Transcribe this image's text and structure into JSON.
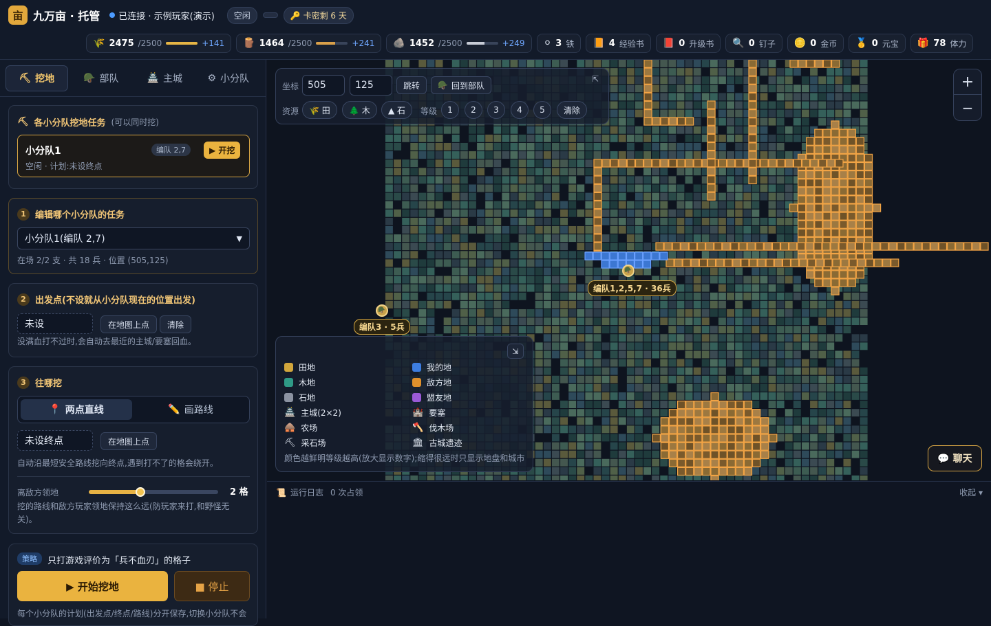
{
  "header": {
    "logo_glyph": "亩",
    "title": "九万亩 · 托管",
    "connection": "已连接 · 示例玩家(演示)",
    "status": "空闲",
    "card_key": "卡密剩 6 天"
  },
  "resources": [
    {
      "icon": "🌾",
      "value": "2475",
      "cap": "/2500",
      "gain": "+141",
      "fill": 0.99,
      "color": "#e6b545"
    },
    {
      "icon": "🪵",
      "value": "1464",
      "cap": "/2500",
      "gain": "+241",
      "fill": 0.59,
      "color": "#d9a04a"
    },
    {
      "icon": "🪨",
      "value": "1452",
      "cap": "/2500",
      "gain": "+249",
      "fill": 0.58,
      "color": "#c8ccd6"
    }
  ],
  "items": [
    {
      "icon": "⚪",
      "value": "3",
      "label": "铁"
    },
    {
      "icon": "📙",
      "value": "4",
      "label": "经验书"
    },
    {
      "icon": "📕",
      "value": "0",
      "label": "升级书"
    },
    {
      "icon": "🔍",
      "value": "0",
      "label": "钉子"
    },
    {
      "icon": "🪙",
      "value": "0",
      "label": "金币"
    },
    {
      "icon": "🥇",
      "value": "0",
      "label": "元宝"
    },
    {
      "icon": "🎁",
      "value": "78",
      "label": "体力"
    }
  ],
  "tabs": [
    {
      "icon": "⛏",
      "label": "挖地"
    },
    {
      "icon": "🪖",
      "label": "部队"
    },
    {
      "icon": "🏯",
      "label": "主城"
    },
    {
      "icon": "⚙",
      "label": "小分队"
    }
  ],
  "dig_tasks": {
    "title": "各小分队挖地任务",
    "hint": "(可以同时挖)",
    "squad_name": "小分队1",
    "squad_tag": "编队 2,7",
    "squad_status": "空闲 · 计划:未设终点",
    "start_label": "▶ 开挖"
  },
  "step1": {
    "num": "1",
    "title": "编辑哪个小分队的任务",
    "selected": "小分队1(编队 2,7)",
    "info": "在场 2/2 支 · 共 18 兵 · 位置 (505,125)"
  },
  "step2": {
    "num": "2",
    "title": "出发点(不设就从小分队现在的位置出发)",
    "value": "未设",
    "pick_label": "在地图上点",
    "clear_label": "清除",
    "note": "没满血打不过时,会自动去最近的主城/要塞回血。"
  },
  "step3": {
    "num": "3",
    "title": "往哪挖",
    "mode_line": "两点直线",
    "mode_draw": "画路线",
    "endpoint": "未设终点",
    "pick_label": "在地图上点",
    "note": "自动沿最短安全路线挖向终点,遇到打不了的格会绕开。",
    "distance_label": "离敌方领地",
    "distance_value": "2 格",
    "distance_fraction": 0.4,
    "distance_note": "挖的路线和敌方玩家领地保持这么远(防玩家来打,和野怪无关)。"
  },
  "strategy": {
    "tag": "策略",
    "text": "只打游戏评价为「兵不血刃」的格子",
    "start": "▶ 开始挖地",
    "stop": "■ 停止",
    "footer": "每个小分队的计划(出发点/终点/路线)分开保存,切换小分队不会"
  },
  "map_controls": {
    "coord_label": "坐标",
    "x": "505",
    "y": "125",
    "jump": "跳转",
    "back": "回到部队",
    "resource_label": "资源",
    "res_filters": [
      "🌾 田",
      "🌲 木",
      "▲ 石"
    ],
    "level_label": "等级",
    "levels": [
      "1",
      "2",
      "3",
      "4",
      "5"
    ],
    "clear": "清除",
    "zoom_in": "+",
    "zoom_out": "−"
  },
  "legend": {
    "left": [
      {
        "kind": "swatch",
        "color": "#d2a63c",
        "label": "田地"
      },
      {
        "kind": "swatch",
        "color": "#2f9a86",
        "label": "木地"
      },
      {
        "kind": "swatch",
        "color": "#8b92a1",
        "label": "石地"
      },
      {
        "kind": "icon",
        "icon": "🏯",
        "label": "主城(2×2)"
      },
      {
        "kind": "icon",
        "icon": "🛖",
        "label": "农场"
      },
      {
        "kind": "icon",
        "icon": "⛏",
        "label": "采石场"
      }
    ],
    "right": [
      {
        "kind": "swatch",
        "color": "#3d7de0",
        "label": "我的地"
      },
      {
        "kind": "swatch",
        "color": "#e0902c",
        "label": "敌方地"
      },
      {
        "kind": "swatch",
        "color": "#9a5ad6",
        "label": "盟友地"
      },
      {
        "kind": "icon",
        "icon": "🏰",
        "label": "要塞"
      },
      {
        "kind": "icon",
        "icon": "🪓",
        "label": "伐木场"
      },
      {
        "kind": "icon",
        "icon": "🏛",
        "label": "古城遗迹"
      }
    ],
    "note": "颜色越鲜明等级越高(放大显示数字);缩得很远时只显示地盘和城市"
  },
  "troops": [
    {
      "label": "编队1,2,5,7 · 36兵"
    },
    {
      "label": "编队3 · 5兵"
    }
  ],
  "chat_label": "💬 聊天",
  "log": {
    "title": "运行日志",
    "count": "0 次占领",
    "collapse": "收起 ▾"
  }
}
